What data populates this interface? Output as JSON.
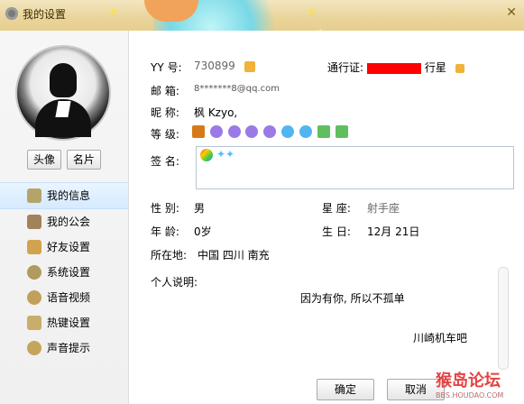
{
  "window": {
    "title": "我的设置",
    "close_icon": "close-icon"
  },
  "sidebar": {
    "buttons": {
      "avatar": "头像",
      "card": "名片"
    },
    "items": [
      {
        "label": "我的信息",
        "icon": "profile-icon",
        "active": true
      },
      {
        "label": "我的公会",
        "icon": "flag-icon",
        "active": false
      },
      {
        "label": "好友设置",
        "icon": "friends-icon",
        "active": false
      },
      {
        "label": "系统设置",
        "icon": "gear-icon",
        "active": false
      },
      {
        "label": "语音视频",
        "icon": "microphone-icon",
        "active": false
      },
      {
        "label": "热键设置",
        "icon": "hotkey-icon",
        "active": false
      },
      {
        "label": "声音提示",
        "icon": "music-icon",
        "active": false
      }
    ]
  },
  "profile": {
    "yy_label": "YY 号:",
    "yy_value": "730899",
    "pass_label": "通行证:",
    "pass_value": "行星",
    "email_label": "邮  箱:",
    "email_value": "8*******8@qq.com",
    "nickname_label": "昵  称:",
    "nickname_value": "枫   Kzyo,",
    "level_label": "等  级:",
    "signature_label": "签  名:",
    "gender_label": "性  别:",
    "gender_value": "男",
    "zodiac_label": "星  座:",
    "zodiac_value": "射手座",
    "age_label": "年  龄:",
    "age_value": "0岁",
    "birthday_label": "生  日:",
    "birthday_value": "12月  21日",
    "location_label": "所在地:",
    "location_value": "中国 四川 南充",
    "about_label": "个人说明:",
    "about_text": "因为有你, 所以不孤单",
    "about_footer": "川崎机车吧"
  },
  "actions": {
    "ok": "确定",
    "cancel": "取消"
  },
  "watermark": {
    "title": "猴岛论坛",
    "url": "BBS.HOUDAO.COM"
  }
}
